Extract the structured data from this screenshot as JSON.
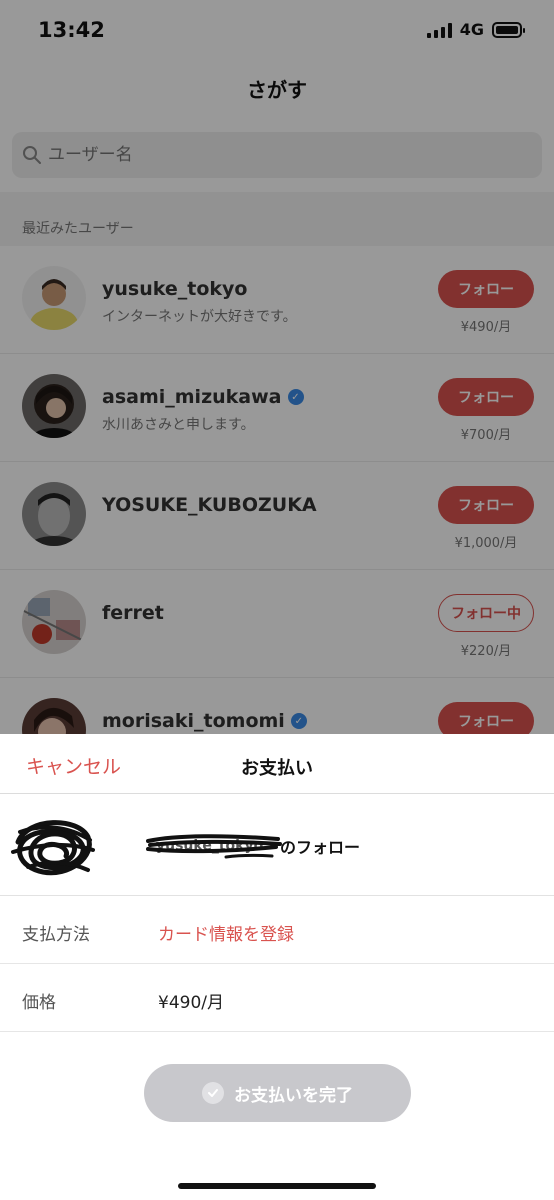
{
  "status_bar": {
    "time": "13:42",
    "network": "4G"
  },
  "nav": {
    "title": "さがす"
  },
  "search": {
    "placeholder": "ユーザー名"
  },
  "section": {
    "title": "最近みたユーザー"
  },
  "users": [
    {
      "name": "yusuke_tokyo",
      "bio": "インターネットが大好きです。",
      "button": "フォロー",
      "price": "¥490/月",
      "verified": false
    },
    {
      "name": "asami_mizukawa",
      "bio": "水川あさみと申します。",
      "button": "フォロー",
      "price": "¥700/月",
      "verified": true
    },
    {
      "name": "YOSUKE_KUBOZUKA",
      "bio": "",
      "button": "フォロー",
      "price": "¥1,000/月",
      "verified": false
    },
    {
      "name": "ferret",
      "bio": "",
      "button": "フォロー中",
      "price": "¥220/月",
      "verified": false
    },
    {
      "name": "morisaki_tomomi",
      "bio": "",
      "button": "フォロー",
      "price": "",
      "verified": true
    }
  ],
  "sheet": {
    "cancel_label": "キャンセル",
    "title": "お支払い",
    "follow_target_name": "yusuke_tokyo",
    "follow_suffix": "のフォロー",
    "payment_method_label": "支払方法",
    "payment_method_value": "カード情報を登録",
    "price_label": "価格",
    "price_value": "¥490/月",
    "complete_label": "お支払いを完了"
  },
  "colors": {
    "accent": "#d9534f",
    "verified": "#3b8be6",
    "disabled_button": "#c8c8cc"
  }
}
